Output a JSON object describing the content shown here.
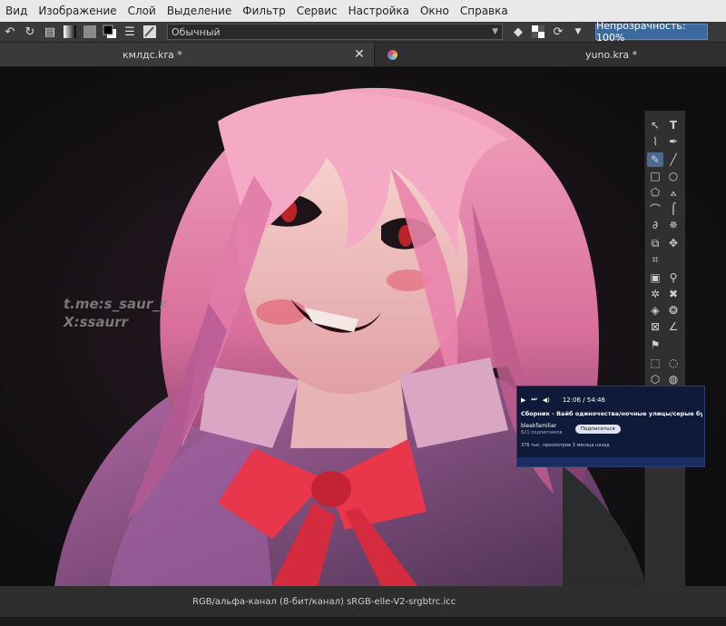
{
  "menu": {
    "items": [
      "Вид",
      "Изображение",
      "Слой",
      "Выделение",
      "Фильтр",
      "Сервис",
      "Настройка",
      "Окно",
      "Справка"
    ]
  },
  "toolbar": {
    "blend_mode": "Обычный",
    "opacity_label": "Непрозрачность: 100%"
  },
  "tabs": [
    {
      "label": "кмлдс.kra *",
      "active": true
    },
    {
      "label": "yuno.kra *",
      "active": false
    }
  ],
  "canvas": {
    "watermark_lines": [
      "t.me:s_saur_r",
      "X:ssaurr"
    ]
  },
  "video_overlay": {
    "time": "12:06 / 54:46",
    "title": "Сборник - Вайб одиночества/ночные улицы/серые будни.",
    "channel": "bleakfamiliar",
    "subscribers": "621 подписчиков",
    "subscribe_label": "Подписаться",
    "stats": "376 тыс. просмотров 3 месяца назад"
  },
  "status": {
    "color_space": "RGB/альфа-канал (8-бит/канал)  sRGB-elle-V2-srgbtrc.icc"
  },
  "colors": {
    "menubar_bg": "#e9e9e9",
    "toolbar_bg": "#3a3a3a",
    "opacity_accent": "#3d6a9e",
    "selected_tool": "#4a6a92"
  }
}
